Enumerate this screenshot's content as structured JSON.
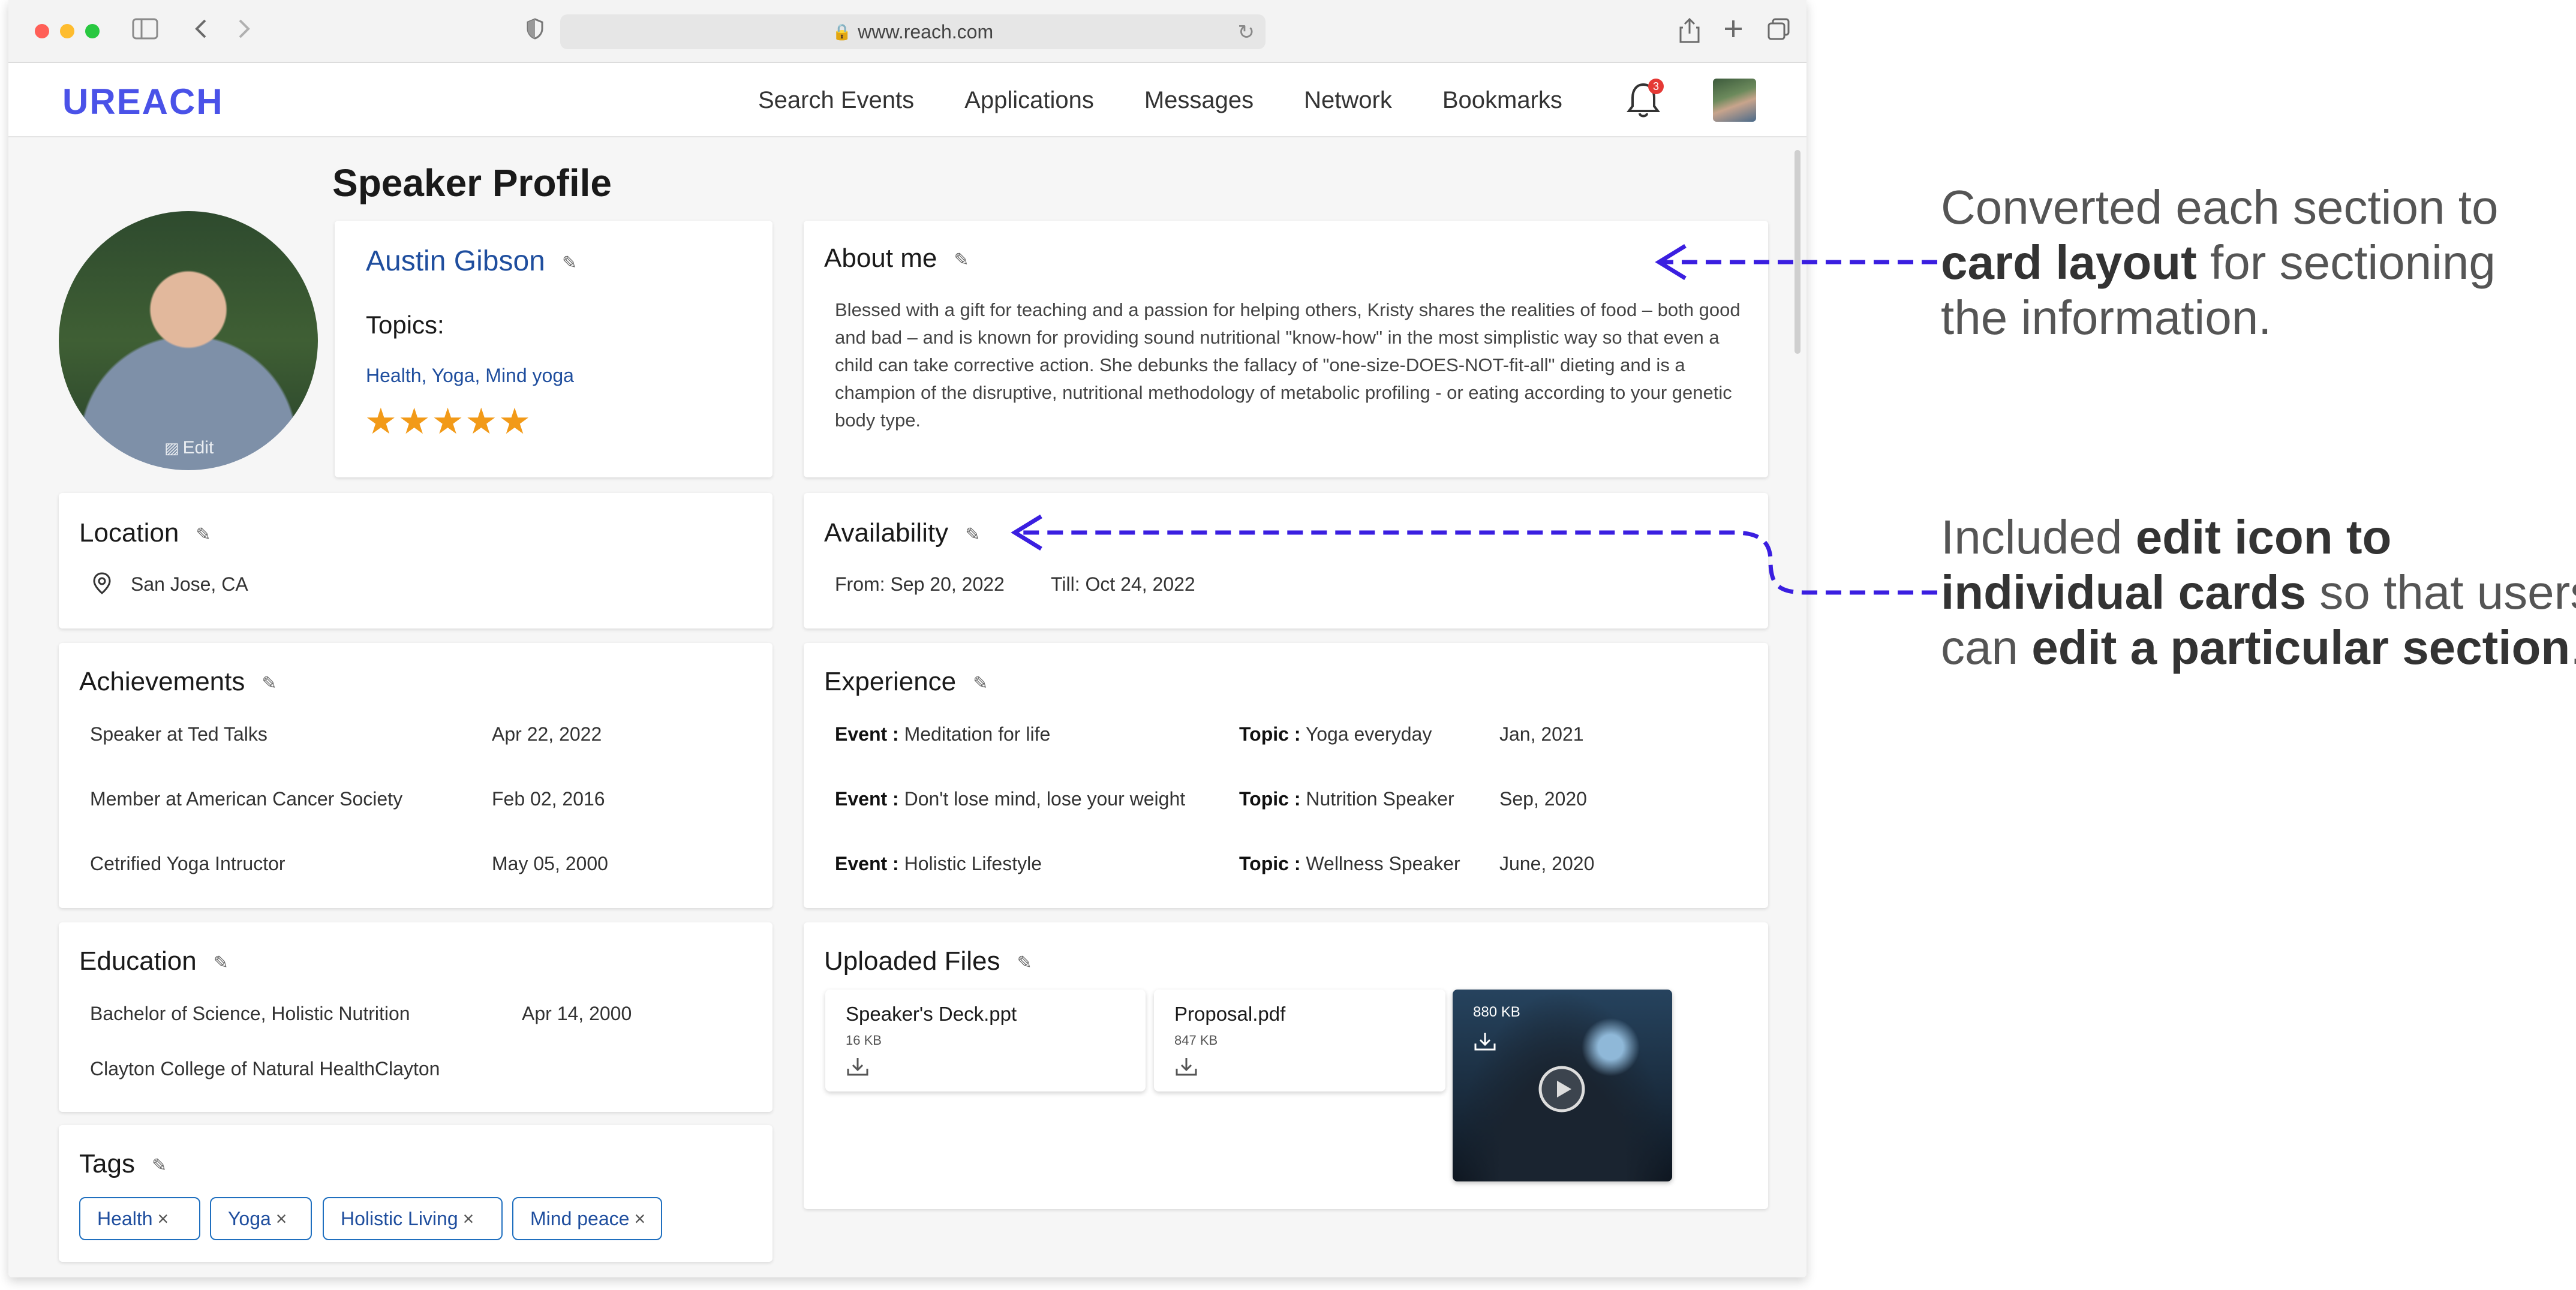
{
  "browser": {
    "url": "www.reach.com"
  },
  "header": {
    "logo": "UREACH",
    "nav": [
      "Search  Events",
      "Applications",
      "Messages",
      "Network",
      "Bookmarks"
    ],
    "notification_count": "3"
  },
  "page": {
    "title": "Speaker Profile",
    "photo_edit_label": "Edit"
  },
  "profile": {
    "name": "Austin Gibson",
    "topics_label": "Topics:",
    "topics": "Health, Yoga, Mind yoga",
    "rating": 5,
    "stars": "★★★★★"
  },
  "about": {
    "title": "About me",
    "text": "Blessed with a gift for teaching and a passion for helping others, Kristy shares the realities of food – both good and bad – and is known for providing sound nutritional \"know-how\" in the most simplistic way so that even a child can take corrective action. She debunks the fallacy of \"one-size-DOES-NOT-fit-all\" dieting and is a champion of the disruptive, nutritional methodology of metabolic profiling - or eating according to your genetic body type."
  },
  "location": {
    "title": "Location",
    "value": "San Jose, CA"
  },
  "availability": {
    "title": "Availability",
    "from": "From: Sep 20, 2022",
    "till": "Till: Oct 24, 2022"
  },
  "achievements": {
    "title": "Achievements",
    "items": [
      {
        "name": "Speaker at Ted Talks",
        "date": "Apr 22, 2022"
      },
      {
        "name": "Member at American Cancer Society",
        "date": "Feb 02, 2016"
      },
      {
        "name": "Cetrified Yoga Intructor",
        "date": "May 05, 2000"
      }
    ]
  },
  "experience": {
    "title": "Experience",
    "event_label": "Event :",
    "topic_label": "Topic :",
    "items": [
      {
        "event": "Meditation for life",
        "topic": "Yoga everyday",
        "date": "Jan, 2021"
      },
      {
        "event": "Don't lose mind, lose your weight",
        "topic": "Nutrition  Speaker",
        "date": "Sep, 2020"
      },
      {
        "event": "Holistic Lifestyle",
        "topic": "Wellness Speaker",
        "date": "June, 2020"
      }
    ]
  },
  "education": {
    "title": "Education",
    "degree": "Bachelor of Science, Holistic Nutrition",
    "date": "Apr 14, 2000",
    "school": "Clayton College of Natural HealthClayton"
  },
  "files": {
    "title": "Uploaded Files",
    "items": [
      {
        "name": "Speaker's Deck.ppt",
        "size": "16 KB"
      },
      {
        "name": "Proposal.pdf",
        "size": "847 KB"
      }
    ],
    "video_size": "880 KB"
  },
  "tags": {
    "title": "Tags",
    "items": [
      "Health",
      "Yoga",
      "Holistic Living",
      "Mind peace"
    ],
    "remove_glyph": "×"
  },
  "annotations": {
    "card_layout": {
      "line1": "Converted each section to",
      "line2_bold": "card layout",
      "line2_rest": " for sectioning",
      "line3": "the information."
    },
    "edit_icon": {
      "line1_pre": "Included ",
      "line1_bold": "edit icon to",
      "line2_bold": "individual cards",
      "line2_rest": " so that users",
      "line3_pre": "can ",
      "line3_bold": "edit a particular section",
      "line3_post": "."
    },
    "arrow_color": "#3a1ee0"
  }
}
